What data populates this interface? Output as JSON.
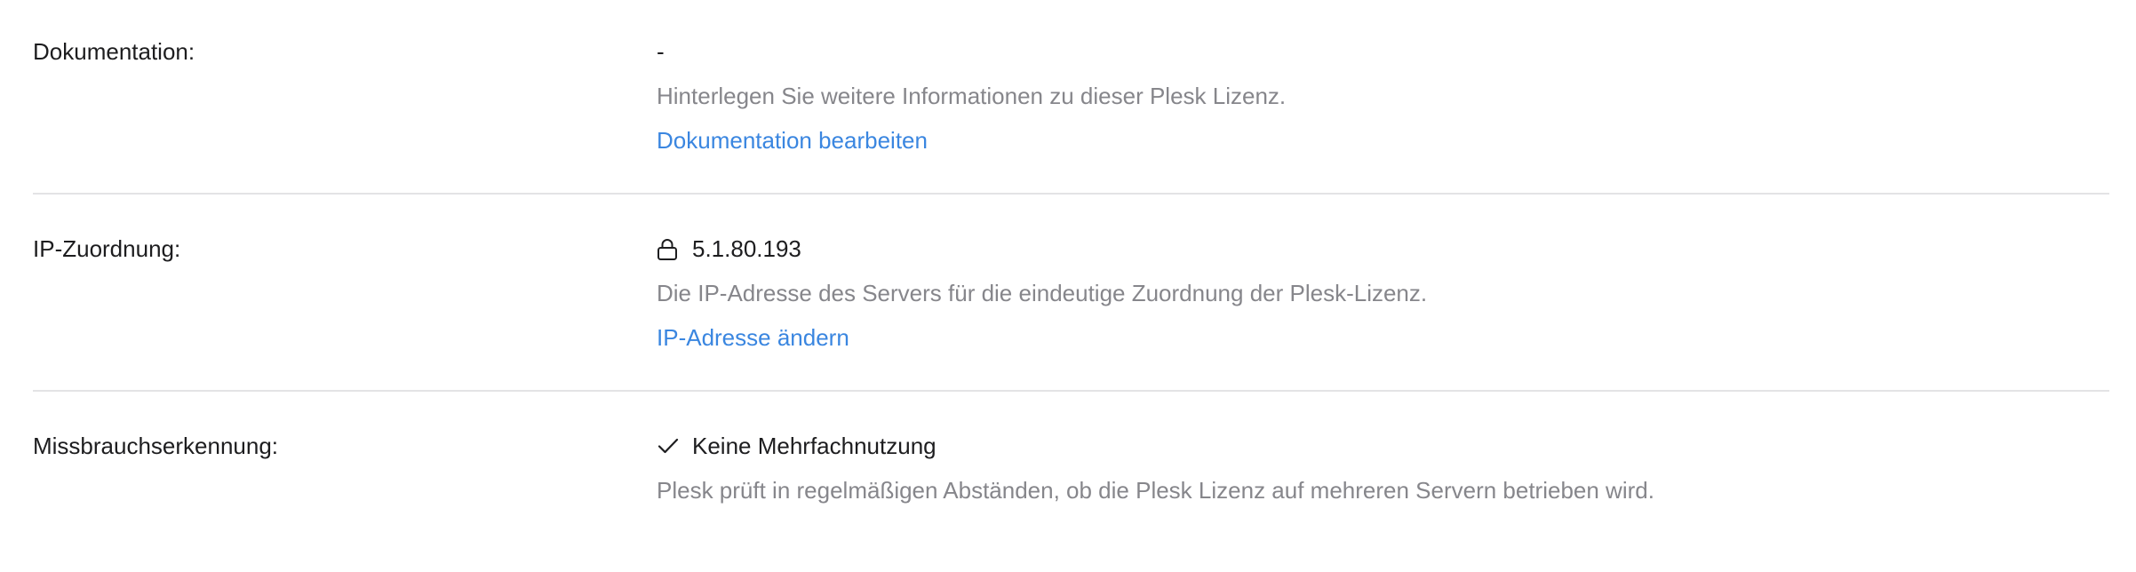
{
  "rows": [
    {
      "label": "Dokumentation:",
      "value": "-",
      "description": "Hinterlegen Sie weitere Informationen zu dieser Plesk Lizenz.",
      "link": "Dokumentation bearbeiten"
    },
    {
      "label": "IP-Zuordnung:",
      "value": "5.1.80.193",
      "icon": "lock-icon",
      "description": "Die IP-Adresse des Servers für die eindeutige Zuordnung der Plesk-Lizenz.",
      "link": "IP-Adresse ändern"
    },
    {
      "label": "Missbrauchserkennung:",
      "value": "Keine Mehrfachnutzung",
      "icon": "checkmark-icon",
      "description": "Plesk prüft in regelmäßigen Abständen, ob die Plesk Lizenz auf mehreren Servern betrieben wird."
    }
  ],
  "colors": {
    "text": "#1d1d1f",
    "muted": "#86868b",
    "link": "#3a86e0",
    "divider": "#e3e3e5"
  }
}
